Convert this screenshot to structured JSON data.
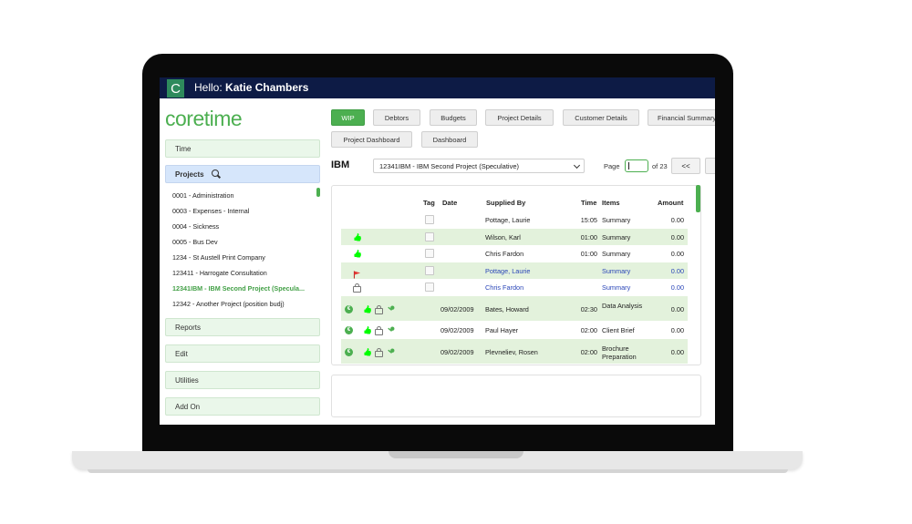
{
  "header": {
    "hello_prefix": "Hello:",
    "user_name": "Katie Chambers",
    "logo_letter": "C"
  },
  "brand": "coretime",
  "sidebar": {
    "time_label": "Time",
    "projects_label": "Projects",
    "projects": [
      "0001 - Administration",
      "0003 - Expenses - Internal",
      "0004 - Sickness",
      "0005 - Bus Dev",
      "1234 - St Austell Print Company",
      "123411 - Harrogate Consultation",
      "12341IBM - IBM Second Project (Specula...",
      "12342 - Another Project (position budj)"
    ],
    "selected_index": 6,
    "menu": [
      "Reports",
      "Edit",
      "Utilities",
      "Add On"
    ]
  },
  "tabs": [
    "WIP",
    "Debtors",
    "Budgets",
    "Project Details",
    "Customer Details",
    "Financial Summary",
    "Project Dashboard",
    "Dashboard"
  ],
  "active_tab": "WIP",
  "client": "IBM",
  "project_select": "12341IBM - IBM Second Project (Speculative)",
  "pager": {
    "page_label": "Page",
    "of_label": "of 23",
    "prev_label": "<<"
  },
  "grid": {
    "headers": {
      "tag": "Tag",
      "date": "Date",
      "supplied_by": "Supplied By",
      "time": "Time",
      "items": "Items",
      "amount": "Amount"
    },
    "rows": [
      {
        "icons": [],
        "date": "",
        "supplied_by": "Pottage, Laurie",
        "time": "15:05",
        "items": "Summary",
        "amount": "0.00",
        "link": false,
        "tag": true
      },
      {
        "icons": [
          "thumb-up-icon"
        ],
        "date": "",
        "supplied_by": "Wilson, Karl",
        "time": "01:00",
        "items": "Summary",
        "amount": "0.00",
        "link": false,
        "tag": true
      },
      {
        "icons": [
          "thumb-up-icon"
        ],
        "date": "",
        "supplied_by": "Chris Fardon",
        "time": "01:00",
        "items": "Summary",
        "amount": "0.00",
        "link": false,
        "tag": true
      },
      {
        "icons": [
          "flag-icon"
        ],
        "date": "",
        "supplied_by": "Pottage, Laurie",
        "time": "",
        "items": "Summary",
        "amount": "0.00",
        "link": true,
        "tag": true
      },
      {
        "icons": [
          "lock-icon"
        ],
        "date": "",
        "supplied_by": "Chris Fardon",
        "time": "",
        "items": "Summary",
        "amount": "0.00",
        "link": true,
        "tag": true
      },
      {
        "icons": [
          "c-icon",
          "thumb-up-icon",
          "lock-icon",
          "key-icon"
        ],
        "date": "09/02/2009",
        "supplied_by": "Bates, Howard",
        "time": "02:30",
        "items": "Data Analysis",
        "amount": "0.00",
        "link": false,
        "tag": false
      },
      {
        "icons": [
          "c-icon",
          "thumb-up-icon",
          "lock-icon",
          "key-icon"
        ],
        "date": "09/02/2009",
        "supplied_by": "Paul Hayer",
        "time": "02:00",
        "items": "Client Brief",
        "amount": "0.00",
        "link": false,
        "tag": false
      },
      {
        "icons": [
          "c-icon",
          "thumb-up-icon",
          "lock-icon",
          "key-icon"
        ],
        "date": "09/02/2009",
        "supplied_by": "Plevneliev, Rosen",
        "time": "02:00",
        "items": "Brochure Preparation",
        "amount": "0.00",
        "link": false,
        "tag": false
      }
    ]
  },
  "colors": {
    "accent": "#4caf50",
    "topbar": "#0d1b45",
    "row_alt": "#e3f2dc",
    "link": "#2a46b8"
  }
}
